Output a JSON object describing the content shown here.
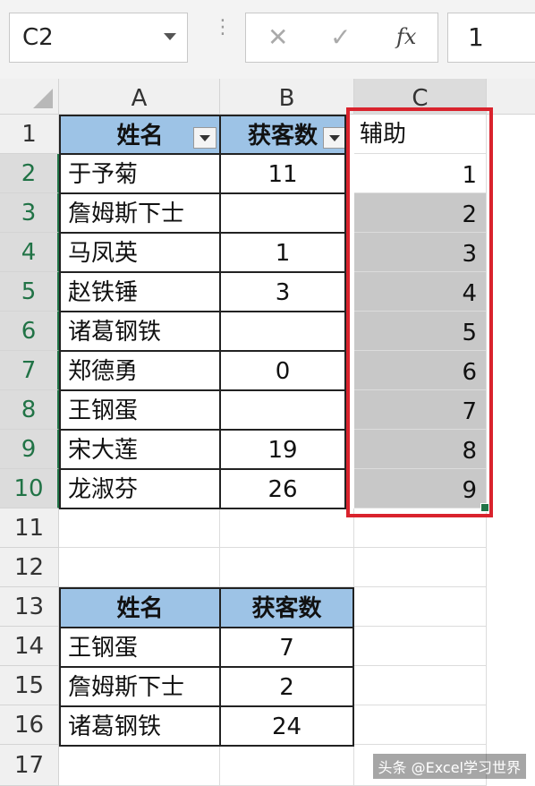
{
  "formula_bar": {
    "name_box": "C2",
    "cancel_icon": "✕",
    "enter_icon": "✓",
    "fx_label": "fx",
    "value": "1"
  },
  "columns": [
    "A",
    "B",
    "C"
  ],
  "rows": [
    "1",
    "2",
    "3",
    "4",
    "5",
    "6",
    "7",
    "8",
    "9",
    "10",
    "11",
    "12",
    "13",
    "14",
    "15",
    "16",
    "17"
  ],
  "table1": {
    "headers": [
      "姓名",
      "获客数",
      "辅助"
    ],
    "rows": [
      {
        "name": "于予菊",
        "count": "11",
        "aux": "1"
      },
      {
        "name": "詹姆斯下士",
        "count": "",
        "aux": "2"
      },
      {
        "name": "马凤英",
        "count": "1",
        "aux": "3"
      },
      {
        "name": "赵铁锤",
        "count": "3",
        "aux": "4"
      },
      {
        "name": "诸葛钢铁",
        "count": "",
        "aux": "5"
      },
      {
        "name": "郑德勇",
        "count": "0",
        "aux": "6"
      },
      {
        "name": "王钢蛋",
        "count": "",
        "aux": "7"
      },
      {
        "name": "宋大莲",
        "count": "19",
        "aux": "8"
      },
      {
        "name": "龙淑芬",
        "count": "26",
        "aux": "9"
      }
    ]
  },
  "table2": {
    "headers": [
      "姓名",
      "获客数"
    ],
    "rows": [
      {
        "name": "王钢蛋",
        "count": "7"
      },
      {
        "name": "詹姆斯下士",
        "count": "2"
      },
      {
        "name": "诸葛钢铁",
        "count": "24"
      }
    ]
  },
  "watermark": "头条 @Excel学习世界",
  "colors": {
    "header_fill": "#9dc3e6",
    "selection_border": "#d9232d",
    "selection_fill": "#c8c8c8"
  }
}
